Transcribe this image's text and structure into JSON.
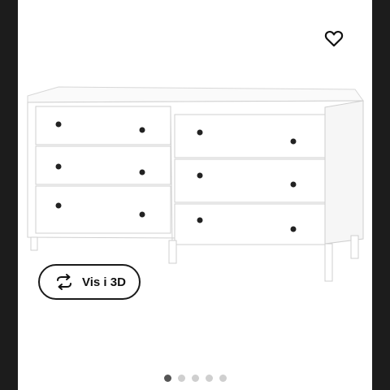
{
  "product": {
    "name_visible": ""
  },
  "actions": {
    "favorite_icon": "heart-icon",
    "view3d_label": "Vis i 3D",
    "view3d_icon": "rotate-arrows-icon"
  },
  "gallery": {
    "total_images": 5,
    "active_index": 0
  },
  "colors": {
    "background_frame": "#1c1c1c",
    "panel": "#ffffff",
    "furniture": "#ffffff",
    "dot_active": "#555555",
    "dot_inactive": "#cfcfcf"
  }
}
